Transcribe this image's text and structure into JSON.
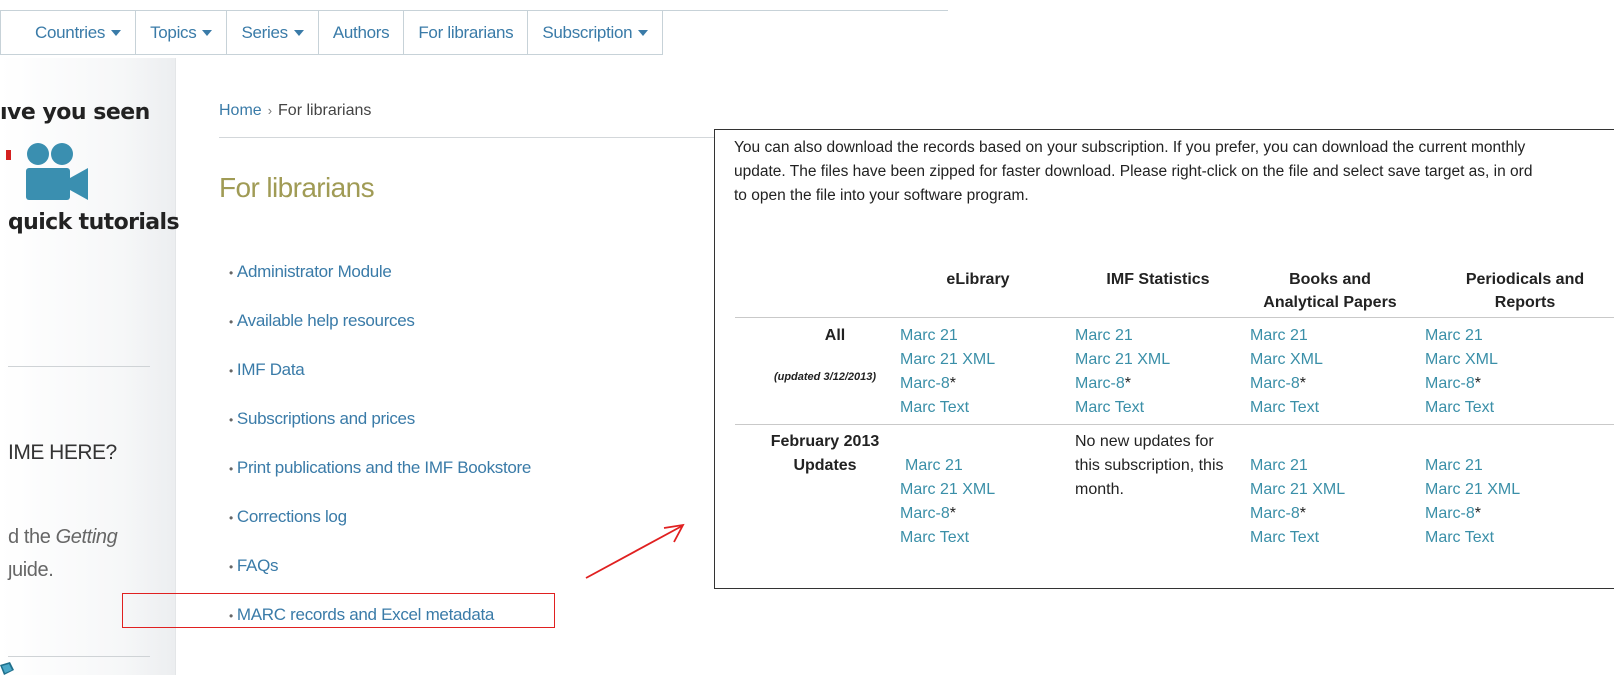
{
  "nav": {
    "items": [
      {
        "label": "Countries",
        "dropdown": true
      },
      {
        "label": "Topics",
        "dropdown": true
      },
      {
        "label": "Series",
        "dropdown": true
      },
      {
        "label": "Authors",
        "dropdown": false
      },
      {
        "label": "For librarians",
        "dropdown": false
      },
      {
        "label": "Subscription",
        "dropdown": true
      }
    ]
  },
  "sidebar": {
    "promo_title": "ıve you seen",
    "promo_subtitle": "quick tutorials",
    "heading": "IME HERE?",
    "text_prefix": "d the ",
    "text_italic": "Getting",
    "text_line2": "ȷuide."
  },
  "breadcrumb": {
    "home": "Home",
    "separator": "›",
    "current": "For librarians"
  },
  "page_title": "For librarians",
  "menu": {
    "items": [
      "Administrator Module",
      "Available help resources",
      "IMF Data",
      "Subscriptions and prices",
      "Print publications and the IMF Bookstore",
      "Corrections log",
      "FAQs",
      "MARC records and Excel metadata"
    ]
  },
  "panel": {
    "intro_lines": [
      "You can also download the records based on your subscription. If you prefer, you can download the current monthly",
      "update. The files have been zipped for faster download. Please right-click on the file and select save target as, in ord",
      "to open the file into your software program."
    ],
    "columns": {
      "elibrary": "eLibrary",
      "imf_statistics": "IMF Statistics",
      "books_line1": "Books and",
      "books_line2": "Analytical Papers",
      "periodicals_line1": "Periodicals and",
      "periodicals_line2": "Reports"
    },
    "row_all": {
      "label": "All",
      "note": "(updated 3/12/2013)",
      "elibrary": {
        "a": "Marc 21",
        "b": "Marc 21 XML",
        "c": "Marc-8",
        "d": "Marc Text"
      },
      "statistics": {
        "a": "Marc 21",
        "b": "Marc 21 XML",
        "c": "Marc-8",
        "d": "Marc Text"
      },
      "books": {
        "a": "Marc 21",
        "b": "Marc XML",
        "c": "Marc-8",
        "d": "Marc Text"
      },
      "periodicals": {
        "a": "Marc 21",
        "b": "Marc XML",
        "c": "Marc-8",
        "d": "Marc Text"
      }
    },
    "row_feb": {
      "label_line1": "February 2013",
      "label_line2": "Updates",
      "elibrary": {
        "a": "Marc 21",
        "b": "Marc 21 XML",
        "c": "Marc-8",
        "d": "Marc Text"
      },
      "statistics_line1": "No new updates for",
      "statistics_line2": "this subscription, this",
      "statistics_line3": "month.",
      "books": {
        "a": "Marc 21",
        "b": "Marc 21 XML",
        "c": "Marc-8",
        "d": "Marc Text"
      },
      "periodicals": {
        "a": "Marc 21",
        "b": "Marc 21 XML",
        "c": "Marc-8",
        "d": "Marc Text"
      }
    },
    "star": "*"
  },
  "colors": {
    "link": "#3a7ba8",
    "title": "#a09b55",
    "highlight": "#e02020",
    "table_link": "#3a8fa8"
  }
}
